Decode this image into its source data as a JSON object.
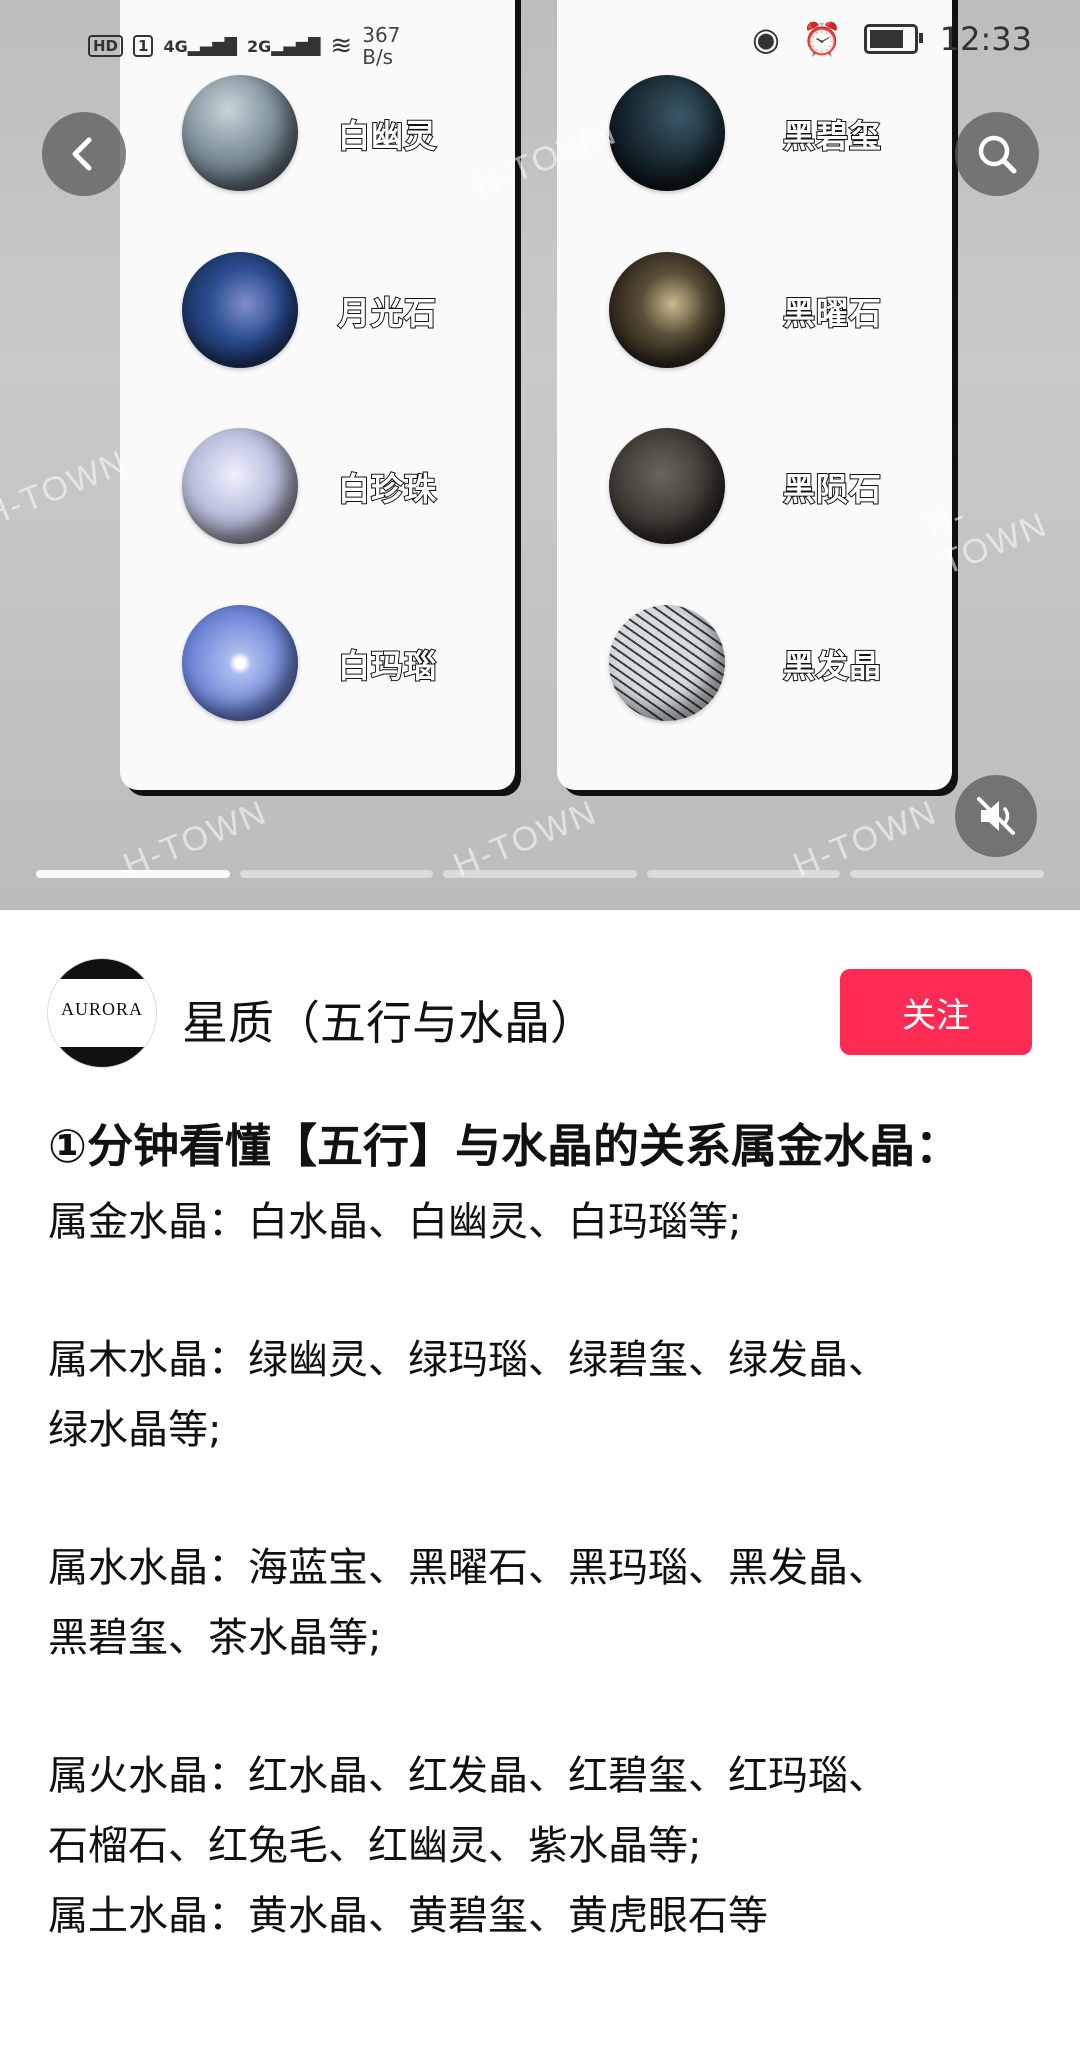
{
  "status_bar": {
    "left_badges": [
      "HD",
      "1"
    ],
    "net1": "4G",
    "net2": "2G",
    "speed": "367\nB/s",
    "time": "12:33"
  },
  "media": {
    "left_column": [
      {
        "label": "白幽灵",
        "color": "#8a9aa3"
      },
      {
        "label": "月光石",
        "color": "#274a86"
      },
      {
        "label": "白珍珠",
        "color": "#c6c9de"
      },
      {
        "label": "白玛瑙",
        "color": "#8ea3df"
      }
    ],
    "right_column": [
      {
        "label": "黑碧玺",
        "color": "#1b2830"
      },
      {
        "label": "黑曜石",
        "color": "#3b3428"
      },
      {
        "label": "黑陨石",
        "color": "#3a3732"
      },
      {
        "label": "黑发晶",
        "color": "#5e6468"
      }
    ],
    "watermark": "H-TOWN",
    "progress_segments": 5,
    "progress_active_index": 0
  },
  "author": {
    "avatar_text": "AURORA",
    "name": "星质（五行与水晶）",
    "follow_label": "关注"
  },
  "post": {
    "title": "①分钟看懂【五行】与水晶的关系属金水晶：",
    "line1": "属金水晶：白水晶、白幽灵、白玛瑙等;",
    "line2a": "属木水晶：绿幽灵、绿玛瑙、绿碧玺、绿发晶、",
    "line2b": "绿水晶等;",
    "line3a": "属水水晶：海蓝宝、黑曜石、黑玛瑙、黑发晶、",
    "line3b": "黑碧玺、茶水晶等;",
    "line4a": "属火水晶：红水晶、红发晶、红碧玺、红玛瑙、",
    "line4b": "石榴石、红兔毛、红幽灵、紫水晶等;",
    "line5": "属土水晶：黄水晶、黄碧玺、黄虎眼石等"
  },
  "colors": {
    "follow": "#fe2c55",
    "text": "#111111"
  }
}
